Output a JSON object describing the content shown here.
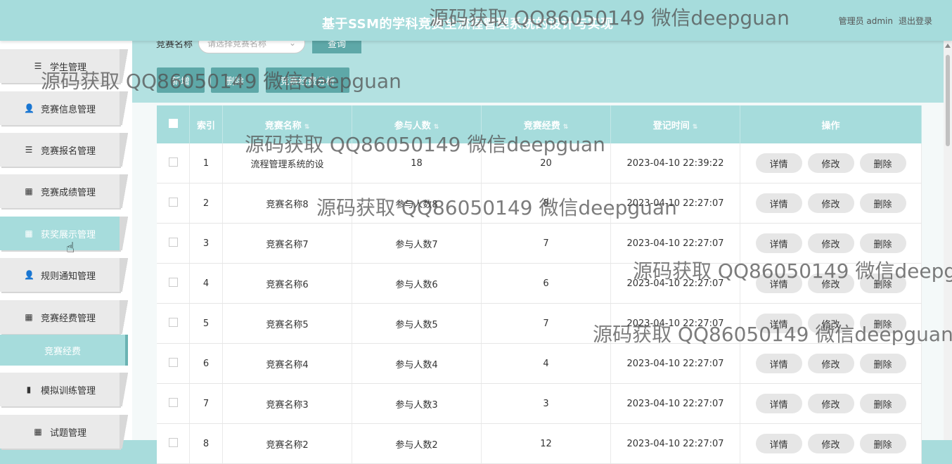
{
  "header": {
    "title": "基于SSM的学科竞赛全流程管理系统的设计与实现",
    "user_label": "管理员 admin",
    "logout_label": "退出登录"
  },
  "sidebar": {
    "items": [
      {
        "label": "学生管理",
        "icon": "list-icon"
      },
      {
        "label": "竞赛信息管理",
        "icon": "user-icon"
      },
      {
        "label": "竞赛报名管理",
        "icon": "list-icon"
      },
      {
        "label": "竞赛成绩管理",
        "icon": "grid-icon"
      },
      {
        "label": "获奖展示管理",
        "icon": "grid-icon",
        "active": true
      },
      {
        "label": "规则通知管理",
        "icon": "user-icon"
      },
      {
        "label": "竞赛经费管理",
        "icon": "grid-icon"
      },
      {
        "label": "模拟训练管理",
        "icon": "bar-chart-icon"
      },
      {
        "label": "试题管理",
        "icon": "grid-icon"
      }
    ],
    "sub_item": "竞赛经费"
  },
  "search": {
    "label": "竞赛名称",
    "placeholder": "请选择竞赛名称",
    "query_label": "查询"
  },
  "actions": {
    "add": "新增",
    "delete": "删除",
    "analysis": "竞赛经费分析"
  },
  "table": {
    "columns": [
      "索引",
      "竞赛名称",
      "参与人数",
      "竞赛经费",
      "登记时间",
      "操作"
    ],
    "row_buttons": [
      "详情",
      "修改",
      "删除"
    ],
    "rows": [
      {
        "index": "1",
        "name": "流程管理系统的设",
        "participants": "18",
        "fund": "20",
        "time": "2023-04-10 22:39:22"
      },
      {
        "index": "2",
        "name": "竞赛名称8",
        "participants": "参与人数8",
        "fund": "8",
        "time": "2023-04-10 22:27:07"
      },
      {
        "index": "3",
        "name": "竞赛名称7",
        "participants": "参与人数7",
        "fund": "7",
        "time": "2023-04-10 22:27:07"
      },
      {
        "index": "4",
        "name": "竞赛名称6",
        "participants": "参与人数6",
        "fund": "6",
        "time": "2023-04-10 22:27:07"
      },
      {
        "index": "5",
        "name": "竞赛名称5",
        "participants": "参与人数5",
        "fund": "7",
        "time": "2023-04-10 22:27:07"
      },
      {
        "index": "6",
        "name": "竞赛名称4",
        "participants": "参与人数4",
        "fund": "4",
        "time": "2023-04-10 22:27:07"
      },
      {
        "index": "7",
        "name": "竞赛名称3",
        "participants": "参与人数3",
        "fund": "3",
        "time": "2023-04-10 22:27:07"
      },
      {
        "index": "8",
        "name": "竞赛名称2",
        "participants": "参与人数2",
        "fund": "12",
        "time": "2023-04-10 22:27:07"
      }
    ]
  },
  "watermark": "源码获取 QQ86050149 微信deepguan"
}
